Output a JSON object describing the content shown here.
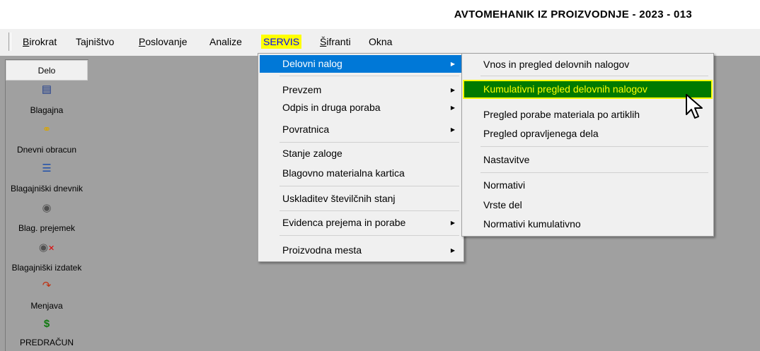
{
  "app_title": "AVTOMEHANIK IZ PROIZVODNJE - 2023 - 013",
  "menu_bar": {
    "items": [
      {
        "label": "Birokrat",
        "underline": true
      },
      {
        "label": "Tajništvo",
        "underline": false
      },
      {
        "label": "Poslovanje",
        "underline": true
      },
      {
        "label": "Analize",
        "underline": false
      },
      {
        "label": "SERVIS",
        "highlighted": true
      },
      {
        "label": "Šifranti",
        "underline": true
      },
      {
        "label": "Okna",
        "underline": false
      }
    ],
    "highlight_color": "#ffff00",
    "highlight_text_color": "#0000ff"
  },
  "toolbar": {
    "header": "Delo",
    "items": [
      {
        "label": "Blagajna",
        "icon": "cash-register-icon"
      },
      {
        "label": "Dnevni obracun",
        "icon": "key-icon"
      },
      {
        "label": "Blagajniški dnevnik",
        "icon": "ledger-icon"
      },
      {
        "label": "Blag. prejemek",
        "icon": "coin-receipt-icon"
      },
      {
        "label": "Blagajniški izdatek",
        "icon": "coin-expense-icon"
      },
      {
        "label": "Menjava",
        "icon": "exchange-icon"
      },
      {
        "label": "PREDRAČUN",
        "icon": "dollar-icon"
      }
    ]
  },
  "servis_menu": {
    "items": [
      {
        "label": "Delovni nalog",
        "submenu": true,
        "selected": true
      },
      {
        "label": "Prevzem",
        "submenu": true
      },
      {
        "label": "Odpis in druga poraba",
        "submenu": true
      },
      {
        "label": "Povratnica",
        "submenu": true
      },
      {
        "label": "Stanje zaloge",
        "submenu": false
      },
      {
        "label": "Blagovno materialna kartica",
        "submenu": false
      },
      {
        "label": "Uskladitev številčnih stanj",
        "submenu": false
      },
      {
        "label": "Evidenca prejema in porabe",
        "submenu": true
      },
      {
        "label": "Proizvodna mesta",
        "submenu": true
      }
    ]
  },
  "delovni_nalog_submenu": {
    "items": [
      {
        "label": "Vnos in pregled delovnih nalogov"
      },
      {
        "label": "Kumulativni pregled delovnih nalogov",
        "highlighted": true
      },
      {
        "label": "Pregled porabe materiala po artiklih"
      },
      {
        "label": "Pregled opravljenega dela"
      },
      {
        "label": "Nastavitve"
      },
      {
        "label": "Normativi"
      },
      {
        "label": "Vrste del"
      },
      {
        "label": "Normativi kumulativno"
      }
    ],
    "highlight_bg": "#007a00",
    "highlight_text": "#ffff00"
  },
  "colors": {
    "workspace": "#a0a0a0",
    "selection_blue": "#0078d7"
  }
}
